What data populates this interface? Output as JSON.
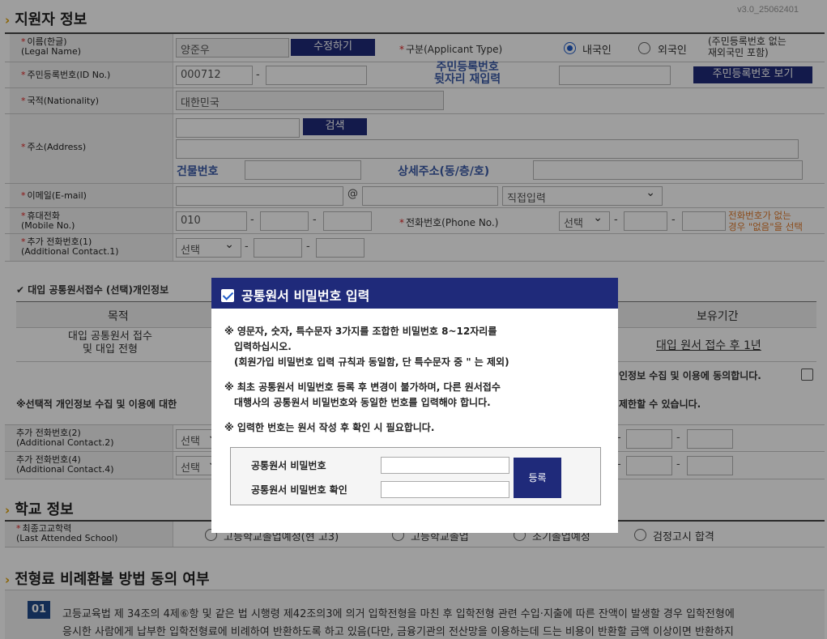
{
  "version": "v3.0_25062401",
  "applicant": {
    "section_title": "지원자 정보",
    "name_label_ko": "이름(한글)",
    "name_label_en": "(Legal Name)",
    "name_value": "양준우",
    "edit_button": "수정하기",
    "type_label": "구분(Applicant Type)",
    "type_domestic": "내국인",
    "type_foreign": "외국인",
    "type_note_1": "(주민등록번호 없는",
    "type_note_2": "재외국민 포함)",
    "id_label": "주민등록번호(ID No.)",
    "id_front": "000712",
    "id_reenter_1": "주민등록번호",
    "id_reenter_2": "뒷자리 재입력",
    "id_show_button": "주민등록번호 보기",
    "nation_label": "국적(Nationality)",
    "nation_value": "대한민국",
    "address_label": "주소(Address)",
    "search_button": "검색",
    "building_no_label": "건물번호",
    "detail_address_label": "상세주소(동/층/호)",
    "email_label": "이메일(E-mail)",
    "email_at": "@",
    "email_domain_select": "직접입력",
    "mobile_label_ko": "휴대전화",
    "mobile_label_en": "(Mobile No.)",
    "mobile_prefix": "010",
    "phone_label": "전화번호(Phone No.)",
    "phone_select": "선택",
    "phone_note_1": "전화번호가 없는",
    "phone_note_2": "경우 \"없음\"을 선택",
    "extra1_label_ko": "추가 전화번호(1)",
    "extra1_label_en": "(Additional Contact.1)",
    "extra1_select": "선택"
  },
  "consent": {
    "title": "대입 공통원서접수 (선택)개인정보",
    "col_purpose": "목적",
    "col_retention": "보유기간",
    "purpose_1": "대입 공통원서 접수",
    "purpose_2": "및 대입 전형",
    "retention_value": "대입 원서 접수 후 1년",
    "agree_text": "인정보 수집 및 이용에 동의합니다.",
    "notice_left": "※선택적 개인정보 수집 및 이용에 대한",
    "notice_right": "제한할 수 있습니다."
  },
  "extra_contacts": {
    "c2_ko": "추가 전화번호(2)",
    "c2_en": "(Additional Contact.2)",
    "c4_ko": "추가 전화번호(4)",
    "c4_en": "(Additional Contact.4)",
    "select": "선택"
  },
  "school": {
    "section_title": "학교 정보",
    "last_school_ko": "최종고교학력",
    "last_school_en": "(Last Attended School)",
    "opt1": "고등학교졸업예정(현 고3)",
    "opt2": "고등학교졸업",
    "opt3": "조기졸업예정",
    "opt4": "검정고시 합격"
  },
  "refund": {
    "section_title": "전형료 비례환불 방법 동의 여부",
    "badge": "01",
    "line1": "고등교육법 제 34조의 4제⑥항 및 같은 법 시행령 제42조의3에 의거 입학전형을 마친 후 입학전형 관련 수입·지출에 따른 잔액이 발생할 경우 입학전형에",
    "line2": "응시한 사람에게 납부한 입학전형료에 비례하여 반환하도록 하고 있음(다만, 금융기관의 전산망을 이용하는데 드는 비용이 반환할 금액 이상이면 반환하지"
  },
  "modal": {
    "title": "공통원서 비밀번호 입력",
    "p1_l1": "※ 영문자, 숫자, 특수문자 3가지를 조합한 비밀번호 8~12자리를",
    "p1_l2": "입력하십시오.",
    "p1_l3": "(회원가입 비밀번호 입력 규칙과 동일함, 단 특수문자 중 \" 는 제외)",
    "p2_l1": "※ 최초 공통원서 비밀번호 등록 후 변경이 불가하며, 다른 원서접수",
    "p2_l2": "대행사의 공통원서 비밀번호와 동일한 번호를 입력해야 합니다.",
    "p3": "※ 입력한 번호는 원서 작성 후 확인 시 필요합니다.",
    "pw_label": "공통원서 비밀번호",
    "pw_confirm_label": "공통원서 비밀번호 확인",
    "register_button": "등록"
  },
  "colors": {
    "accent": "#1f2a7a",
    "required": "#dd2222",
    "note_orange": "#e07a2a",
    "link_blue": "#3a5ba8"
  }
}
